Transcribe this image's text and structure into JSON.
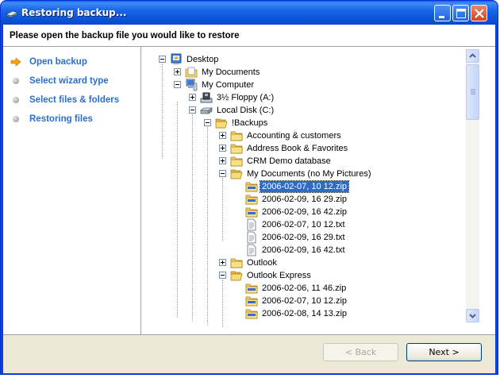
{
  "window": {
    "title": "Restoring backup..."
  },
  "header": {
    "text": "Please open the backup file you would like to restore"
  },
  "steps": [
    {
      "label": "Open backup",
      "state": "current",
      "icon": "arrow-icon"
    },
    {
      "label": "Select wizard type",
      "state": "pending",
      "icon": "dot-icon"
    },
    {
      "label": "Select files & folders",
      "state": "pending",
      "icon": "dot-icon"
    },
    {
      "label": "Restoring files",
      "state": "pending",
      "icon": "dot-icon"
    }
  ],
  "tree": [
    {
      "label": "Desktop",
      "icon": "desktop-icon",
      "expander": "minus"
    },
    {
      "label": "My Documents",
      "icon": "my-documents-icon",
      "expander": "plus"
    },
    {
      "label": "My Computer",
      "icon": "computer-icon",
      "expander": "minus"
    },
    {
      "label": "3½ Floppy (A:)",
      "icon": "floppy-icon",
      "expander": "plus"
    },
    {
      "label": "Local Disk (C:)",
      "icon": "disk-icon",
      "expander": "minus"
    },
    {
      "label": "!Backups",
      "icon": "folder-open-icon",
      "expander": "minus"
    },
    {
      "label": "Accounting & customers",
      "icon": "folder-icon",
      "expander": "plus"
    },
    {
      "label": "Address Book & Favorites",
      "icon": "folder-icon",
      "expander": "plus"
    },
    {
      "label": "CRM Demo database",
      "icon": "folder-icon",
      "expander": "plus"
    },
    {
      "label": "My Documents (no My Pictures)",
      "icon": "folder-open-icon",
      "expander": "minus"
    },
    {
      "label": "2006-02-07, 10 12.zip",
      "icon": "zip-icon",
      "expander": "none",
      "selected": true
    },
    {
      "label": "2006-02-09, 16 29.zip",
      "icon": "zip-icon",
      "expander": "none"
    },
    {
      "label": "2006-02-09, 16 42.zip",
      "icon": "zip-icon",
      "expander": "none"
    },
    {
      "label": "2006-02-07, 10 12.txt",
      "icon": "text-file-icon",
      "expander": "none"
    },
    {
      "label": "2006-02-09, 16 29.txt",
      "icon": "text-file-icon",
      "expander": "none"
    },
    {
      "label": "2006-02-09, 16 42.txt",
      "icon": "text-file-icon",
      "expander": "none"
    },
    {
      "label": "Outlook",
      "icon": "folder-icon",
      "expander": "plus"
    },
    {
      "label": "Outlook Express",
      "icon": "folder-open-icon",
      "expander": "minus"
    },
    {
      "label": "2006-02-06, 11 46.zip",
      "icon": "zip-icon",
      "expander": "none"
    },
    {
      "label": "2006-02-07, 10 12.zip",
      "icon": "zip-icon",
      "expander": "none"
    },
    {
      "label": "2006-02-08, 14 13.zip",
      "icon": "zip-icon",
      "expander": "none"
    }
  ],
  "buttons": {
    "back": "< Back",
    "next": "Next >"
  },
  "colors": {
    "step_text": "#2a6fcd",
    "selection": "#316ac5",
    "titlebar": "#0a52d8",
    "footer": "#ece9d8"
  }
}
